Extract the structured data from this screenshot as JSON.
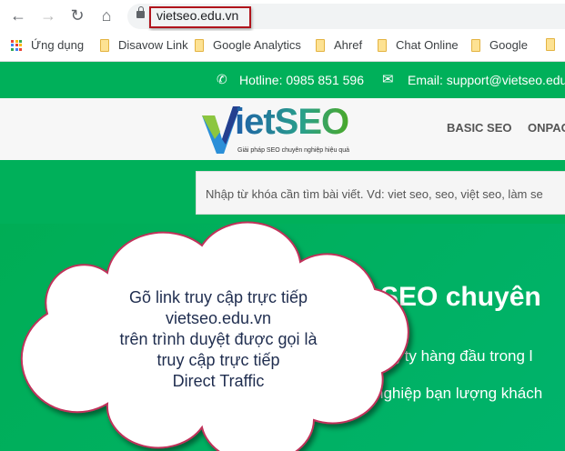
{
  "browser": {
    "url": "vietseo.edu.vn",
    "bookmarks": [
      {
        "label": "Ứng dụng",
        "icon": "apps-grid-icon"
      },
      {
        "label": "Disavow Link",
        "icon": "folder-icon"
      },
      {
        "label": "Google Analytics",
        "icon": "folder-icon"
      },
      {
        "label": "Ahref",
        "icon": "folder-icon"
      },
      {
        "label": "Chat Online",
        "icon": "folder-icon"
      },
      {
        "label": "Google",
        "icon": "folder-icon"
      }
    ],
    "highlight_color": "#b0141c"
  },
  "site": {
    "hotline": "Hotline: 0985 851 596",
    "email": "Email: support@vietseo.edu",
    "logo_text": "ietSEO",
    "tagline": "Giải pháp SEO chuyên nghiệp hiệu quả",
    "menu": [
      "BASIC SEO",
      "ONPAG"
    ],
    "search_placeholder": "Nhập từ khóa cần tìm bài viết. Vd: viet seo, seo, việt seo, làm se",
    "hero_title": "SEO chuyên",
    "hero_lines": [
      "ng ty hàng đầu trong l",
      "nghiệp bạn lượng khách"
    ],
    "brand_color": "#00b05a"
  },
  "callout": {
    "lines": [
      "Gõ link truy cập trực tiếp",
      "vietseo.edu.vn",
      "trên trình duyệt được gọi là",
      "truy cập trực tiếp",
      "Direct Traffic"
    ],
    "border_color": "#c0305a"
  }
}
